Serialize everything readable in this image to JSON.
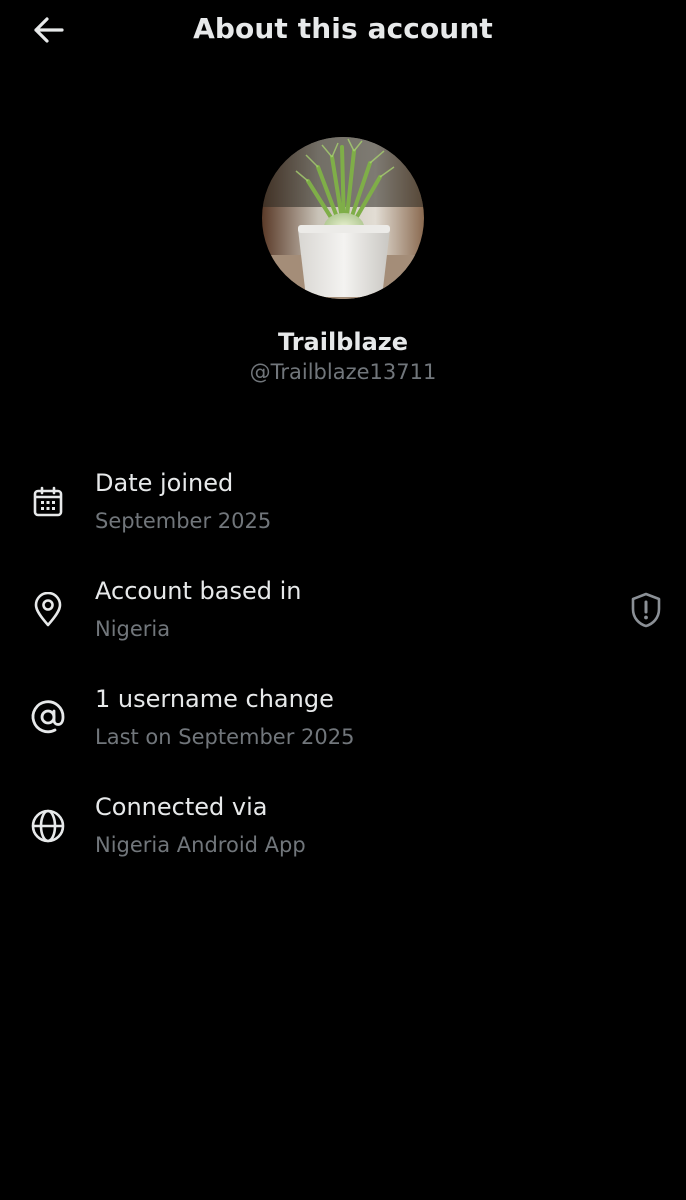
{
  "header": {
    "title": "About this account",
    "back_icon": "arrow-left-icon"
  },
  "profile": {
    "display_name": "Trailblaze",
    "handle": "@Trailblaze13711",
    "avatar_description_icon": "avatar-plant-image"
  },
  "rows": [
    {
      "icon": "calendar-icon",
      "title": "Date joined",
      "subtitle": "September 2025"
    },
    {
      "icon": "location-pin-icon",
      "title": "Account based in",
      "subtitle": "Nigeria",
      "badge_icon": "shield-alert-icon"
    },
    {
      "icon": "at-sign-icon",
      "title": "1 username change",
      "subtitle": "Last on September 2025"
    },
    {
      "icon": "globe-icon",
      "title": "Connected via",
      "subtitle": "Nigeria Android App"
    }
  ],
  "colors": {
    "background": "#000000",
    "primary_text": "#e7e9ea",
    "secondary_text": "#71767b"
  }
}
